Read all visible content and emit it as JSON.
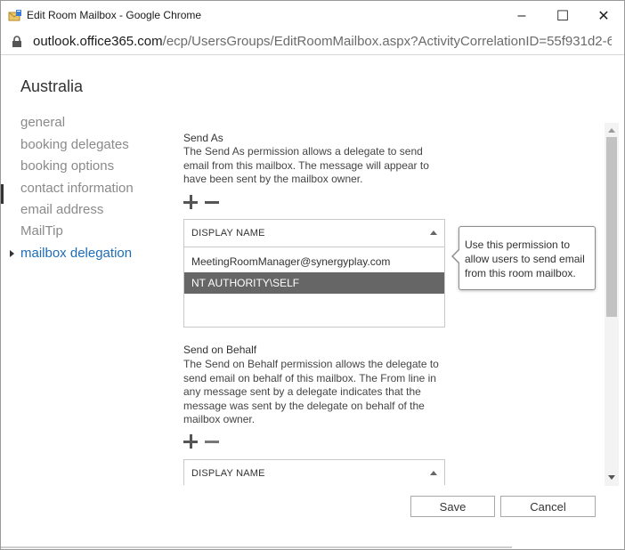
{
  "window": {
    "title": "Edit Room Mailbox - Google Chrome",
    "controls": {
      "minimize": "–",
      "maximize": "☐",
      "close": "✕"
    }
  },
  "address": {
    "host": "outlook.office365.com",
    "path": "/ecp/UsersGroups/EditRoomMailbox.aspx?ActivityCorrelationID=55f931d2-6419-6..."
  },
  "mailbox": {
    "name": "Australia"
  },
  "nav": {
    "items": [
      {
        "label": "general"
      },
      {
        "label": "booking delegates"
      },
      {
        "label": "booking options"
      },
      {
        "label": "contact information"
      },
      {
        "label": "email address"
      },
      {
        "label": "MailTip"
      },
      {
        "label": "mailbox delegation",
        "active": true
      }
    ]
  },
  "send_as": {
    "title": "Send As",
    "description": "The Send As permission allows a delegate to send email from this mailbox. The message will appear to have been sent by the mailbox owner.",
    "column_header": "DISPLAY NAME",
    "rows": [
      {
        "name": "MeetingRoomManager@synergyplay.com",
        "selected": false
      },
      {
        "name": "NT AUTHORITY\\SELF",
        "selected": true
      }
    ]
  },
  "send_on_behalf": {
    "title": "Send on Behalf",
    "description": "The Send on Behalf permission allows the delegate to send email on behalf of this mailbox. The From line in any message sent by a delegate indicates that the message was sent by the delegate on behalf of the mailbox owner.",
    "column_header": "DISPLAY NAME"
  },
  "tooltip": {
    "text": "Use this permission to allow users to send email from this room mailbox."
  },
  "footer": {
    "save_label": "Save",
    "cancel_label": "Cancel"
  },
  "colors": {
    "active_nav": "#1e6cb8",
    "nav_text": "#8a8a8a",
    "selected_row_bg": "#666666",
    "selected_row_text": "#ffffff"
  }
}
